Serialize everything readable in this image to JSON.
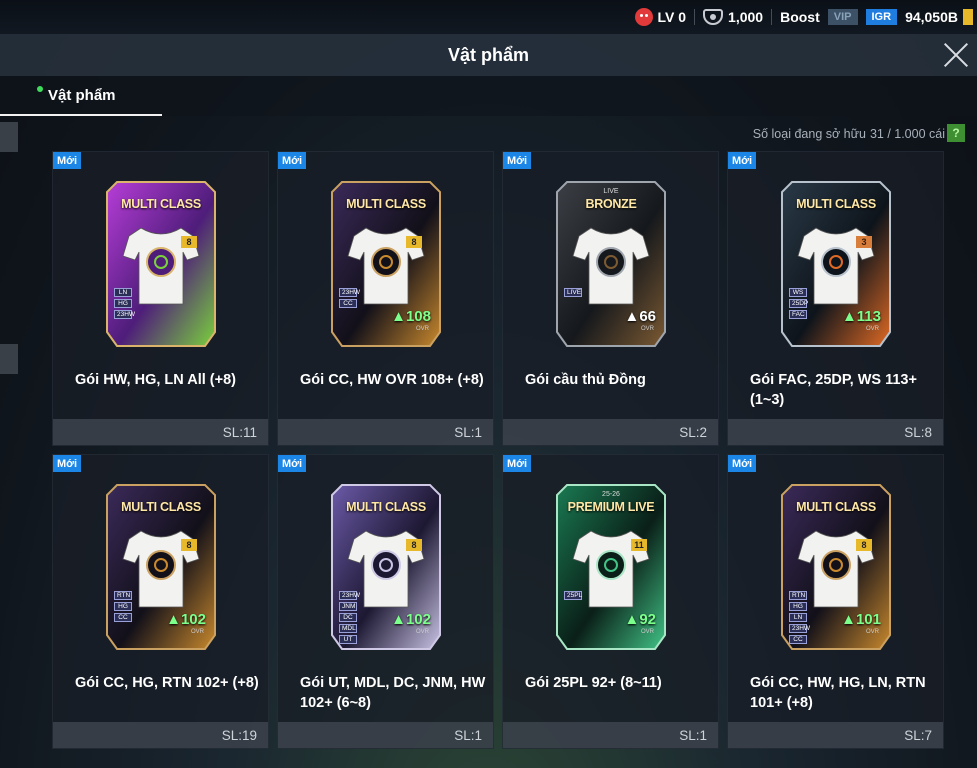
{
  "status": {
    "level": "LV 0",
    "coins": "1,000",
    "boost": "Boost",
    "vip": "VIP",
    "igr": "IGR",
    "balance": "94,050B"
  },
  "header": {
    "title": "Vật phẩm"
  },
  "tabs": [
    {
      "label": "Vật phẩm"
    }
  ],
  "ownership": {
    "label": "Số loại đang sở hữu",
    "count": "31 / 1.000 cái",
    "help": "?"
  },
  "colors": {
    "accent": "#1c86e6",
    "up_green": "#7dff8c",
    "new_badge": "#1c86e6",
    "help_green": "#3e8f31"
  },
  "items": [
    {
      "badge": "Mới",
      "name": "Gói HW, HG, LN All (+8)",
      "qty": "SL:11",
      "card": {
        "title": "MULTI CLASS",
        "sub": "",
        "rating": "",
        "ovr": "",
        "level": "8",
        "tags": [
          "LN",
          "HG",
          "23HW"
        ],
        "theme": "neon"
      }
    },
    {
      "badge": "Mới",
      "name": "Gói CC, HW OVR 108+ (+8)",
      "qty": "SL:1",
      "card": {
        "title": "MULTI CLASS",
        "sub": "",
        "rating": "108",
        "ovr": "OVR",
        "level": "8",
        "tags": [
          "23HW",
          "CC"
        ],
        "theme": "dark"
      }
    },
    {
      "badge": "Mới",
      "name": "Gói cầu thủ Đồng",
      "qty": "SL:2",
      "card": {
        "title": "BRONZE",
        "sub": "LIVE",
        "rating": "66",
        "ovr": "OVR",
        "level": "",
        "tags": [
          "LIVE"
        ],
        "theme": "bronze"
      }
    },
    {
      "badge": "Mới",
      "name": "Gói FAC, 25DP, WS 113+ (1~3)",
      "qty": "SL:8",
      "card": {
        "title": "MULTI CLASS",
        "sub": "",
        "rating": "113",
        "ovr": "OVR",
        "level": "3",
        "tags": [
          "WS",
          "25DP",
          "FAC"
        ],
        "theme": "fire"
      }
    },
    {
      "badge": "Mới",
      "name": "Gói CC, HG, RTN 102+ (+8)",
      "qty": "SL:19",
      "card": {
        "title": "MULTI CLASS",
        "sub": "",
        "rating": "102",
        "ovr": "OVR",
        "level": "8",
        "tags": [
          "RTN",
          "HG",
          "CC"
        ],
        "theme": "dark"
      }
    },
    {
      "badge": "Mới",
      "name": "Gói UT, MDL, DC, JNM, HW 102+ (6~8)",
      "qty": "SL:1",
      "card": {
        "title": "MULTI CLASS",
        "sub": "",
        "rating": "102",
        "ovr": "OVR",
        "level": "8",
        "tags": [
          "23HW",
          "JNM",
          "DC",
          "MDL",
          "UT"
        ],
        "theme": "purple"
      }
    },
    {
      "badge": "Mới",
      "name": "Gói 25PL 92+ (8~11)",
      "qty": "SL:1",
      "card": {
        "title": "PREMIUM LIVE",
        "sub": "25-26",
        "rating": "92",
        "ovr": "OVR",
        "level": "11",
        "tags": [
          "25PL"
        ],
        "theme": "green"
      }
    },
    {
      "badge": "Mới",
      "name": "Gói CC, HW, HG, LN, RTN 101+ (+8)",
      "qty": "SL:7",
      "card": {
        "title": "MULTI CLASS",
        "sub": "",
        "rating": "101",
        "ovr": "OVR",
        "level": "8",
        "tags": [
          "RTN",
          "HG",
          "LN",
          "23HW",
          "CC"
        ],
        "theme": "dark"
      }
    }
  ]
}
